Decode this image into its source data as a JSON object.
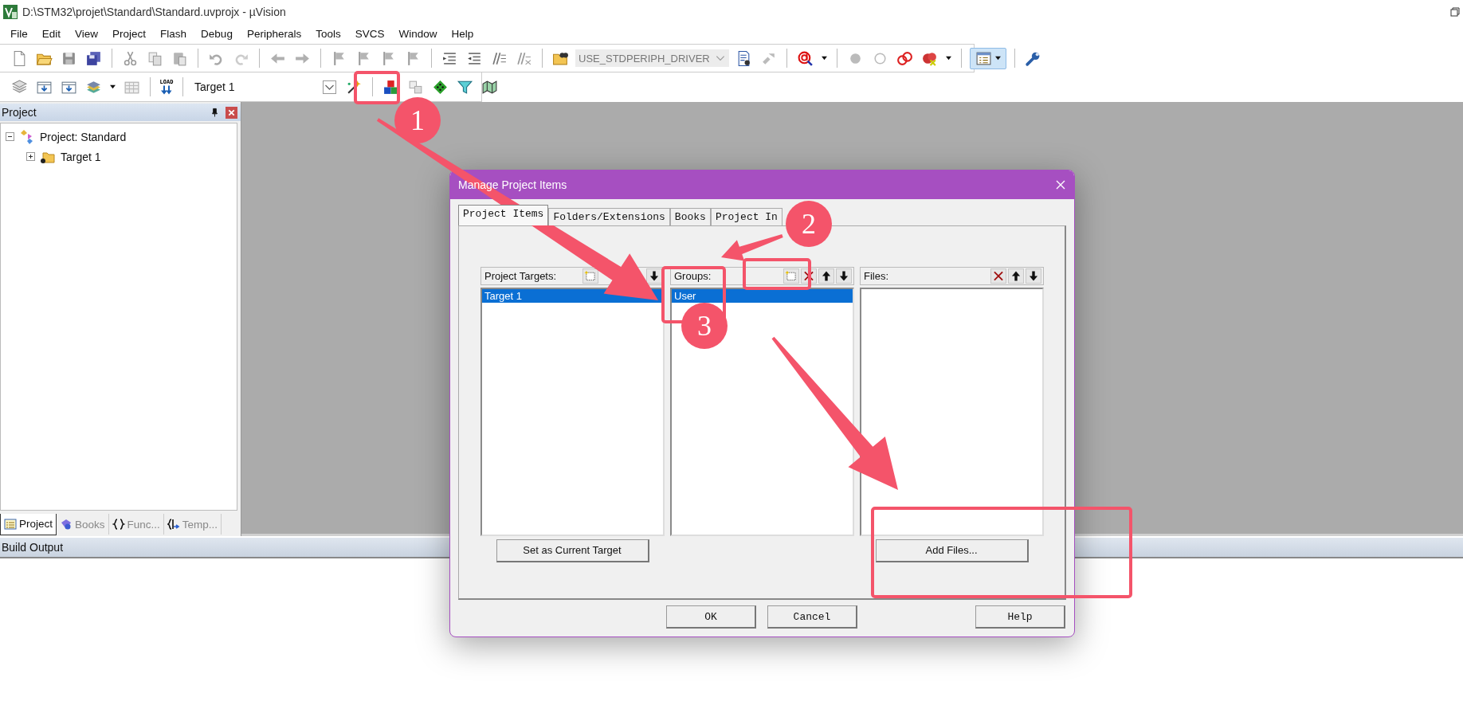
{
  "window": {
    "title": "D:\\STM32\\projet\\Standard\\Standard.uvprojx - µVision"
  },
  "menu": [
    "File",
    "Edit",
    "View",
    "Project",
    "Flash",
    "Debug",
    "Peripherals",
    "Tools",
    "SVCS",
    "Window",
    "Help"
  ],
  "toolbar": {
    "define_combo": {
      "value": "USE_STDPERIPH_DRIVER",
      "disabled": true
    },
    "window_button": {
      "on": true
    },
    "load_label": "LOAD",
    "target_combo": {
      "value": "Target 1"
    }
  },
  "project_panel": {
    "title": "Project",
    "tree": [
      {
        "label": "Project: Standard",
        "expanded": true,
        "children": [
          {
            "label": "Target 1",
            "expanded": false
          }
        ]
      }
    ],
    "tabs": [
      {
        "label": "Project",
        "selected": true
      },
      {
        "label": "Books",
        "selected": false
      },
      {
        "label": "Func...",
        "selected": false
      },
      {
        "label": "Temp...",
        "selected": false
      }
    ]
  },
  "build_output": {
    "title": "Build Output"
  },
  "dialog": {
    "title": "Manage Project Items",
    "tabs": [
      {
        "label": "Project Items",
        "selected": true
      },
      {
        "label": "Folders/Extensions",
        "selected": false
      },
      {
        "label": "Books",
        "selected": false
      },
      {
        "label": "Project In",
        "selected": false
      }
    ],
    "lists": [
      {
        "title": "Project Targets:",
        "tools": [
          {
            "kind": "new"
          },
          {
            "kind": "down"
          }
        ],
        "items": [
          {
            "label": "Target 1",
            "selected": true
          }
        ],
        "action": "Set as Current Target"
      },
      {
        "title": "Groups:",
        "tools": [
          {
            "kind": "new"
          },
          {
            "kind": "delete"
          },
          {
            "kind": "up"
          },
          {
            "kind": "down"
          }
        ],
        "items": [
          {
            "label": "User",
            "selected": true
          }
        ]
      },
      {
        "title": "Files:",
        "tools": [
          {
            "kind": "delete"
          },
          {
            "kind": "up"
          },
          {
            "kind": "down"
          }
        ],
        "action": "Add Files..."
      }
    ],
    "buttons": [
      "OK",
      "Cancel",
      "Help"
    ]
  },
  "annotations": {
    "markers": [
      "1",
      "2",
      "3"
    ]
  }
}
